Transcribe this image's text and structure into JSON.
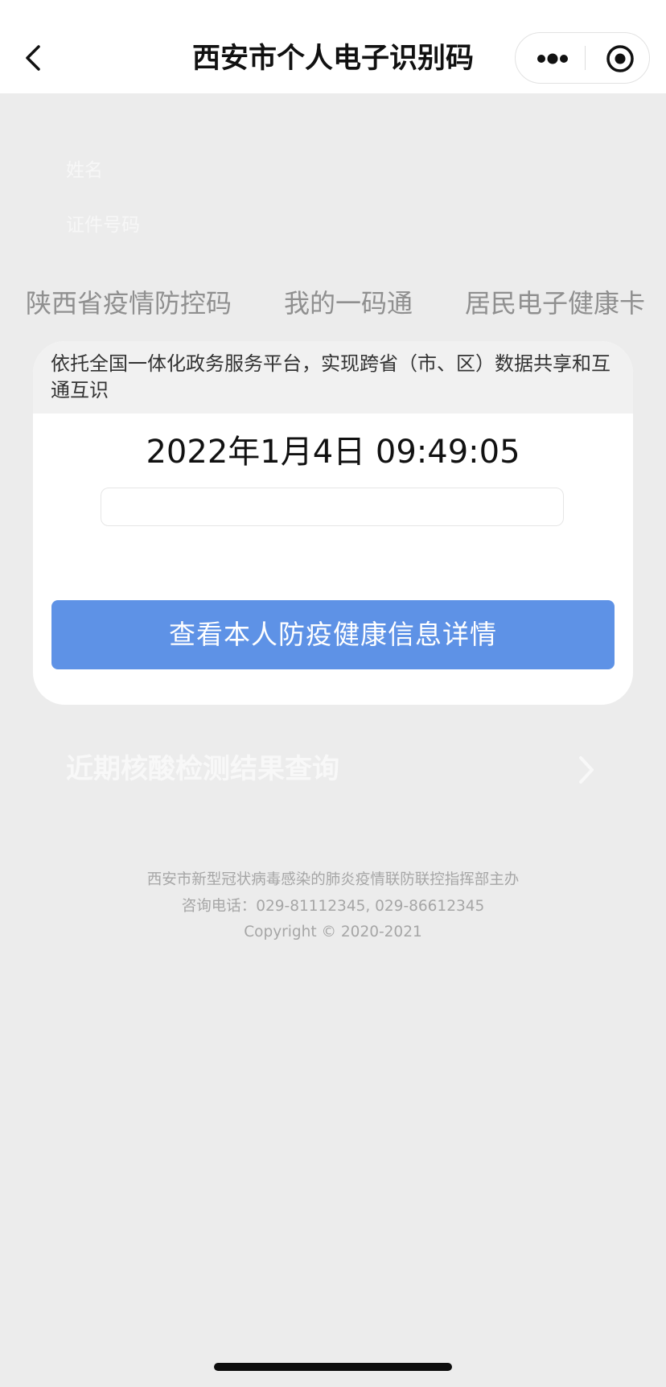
{
  "nav": {
    "title": "西安市个人电子识别码",
    "back_icon": "chevron-left-icon",
    "more_icon": "more-dots-icon",
    "close_icon": "target-circle-icon"
  },
  "profile": {
    "name_label": "姓名",
    "id_label": "证件号码"
  },
  "tabs": [
    {
      "label": "陕西省疫情防控码"
    },
    {
      "label": "我的一码通"
    },
    {
      "label": "居民电子健康卡"
    }
  ],
  "card": {
    "notice": "依托全国一体化政务服务平台，实现跨省（市、区）数据共享和互通互识",
    "datetime": "2022年1月4日 09:49:05",
    "input_value": "",
    "button_label": "查看本人防疫健康信息详情"
  },
  "nucleic": {
    "label": "近期核酸检测结果查询",
    "arrow_icon": "chevron-right-icon"
  },
  "footer": {
    "organizer": "西安市新型冠状病毒感染的肺炎疫情联防联控指挥部主办",
    "phone": "咨询电话：029-81112345, 029-86612345",
    "copyright": "Copyright © 2020-2021"
  },
  "colors": {
    "page_background": "#ececec",
    "nav_background": "#ffffff",
    "button_blue": "#5e92e6",
    "tab_text": "#8f8f8f",
    "footer_text": "#a6a6a6"
  }
}
